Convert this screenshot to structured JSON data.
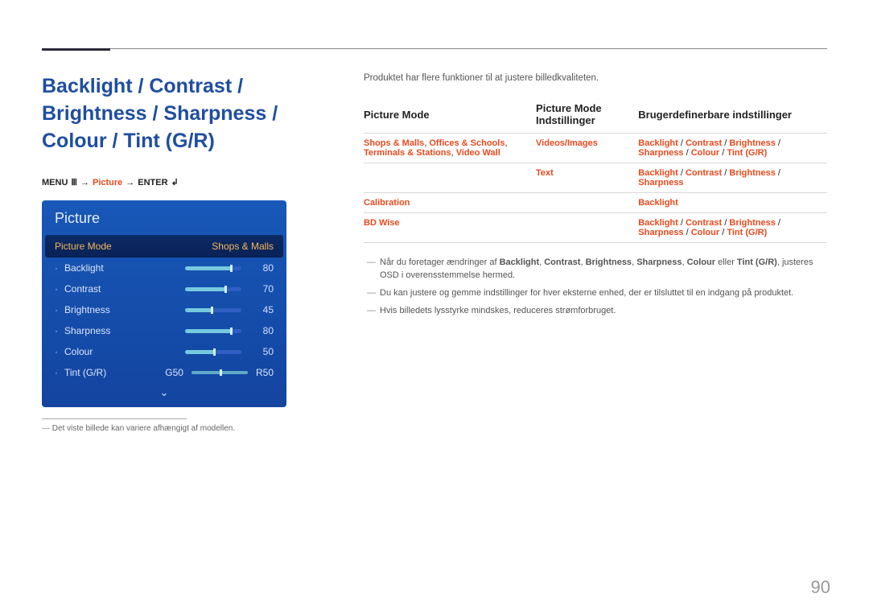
{
  "page_number": "90",
  "title": "Backlight / Contrast / Brightness / Sharpness / Colour / Tint (G/R)",
  "breadcrumb": {
    "menu": "MENU",
    "arrow": "→",
    "picture": "Picture",
    "enter": "ENTER"
  },
  "osd": {
    "header": "Picture",
    "mode_label": "Picture Mode",
    "mode_value": "Shops & Malls",
    "rows": [
      {
        "label": "Backlight",
        "value": "80",
        "pct": "80%"
      },
      {
        "label": "Contrast",
        "value": "70",
        "pct": "70%"
      },
      {
        "label": "Brightness",
        "value": "45",
        "pct": "45%"
      },
      {
        "label": "Sharpness",
        "value": "80",
        "pct": "80%"
      },
      {
        "label": "Colour",
        "value": "50",
        "pct": "50%"
      }
    ],
    "tint": {
      "label": "Tint (G/R)",
      "g": "G50",
      "r": "R50"
    }
  },
  "left_footnote": "Det viste billede kan variere afhængigt af modellen.",
  "intro": "Produktet har flere funktioner til at justere billedkvaliteten.",
  "table": {
    "headers": [
      "Picture Mode",
      "Picture Mode Indstillinger",
      "Brugerdefinerbare indstillinger"
    ],
    "rows": [
      {
        "c1_parts": [
          "Shops & Malls",
          ", ",
          "Offices & Schools",
          ", ",
          "Terminals & Stations",
          ", ",
          "Video Wall"
        ],
        "c2": "Videos/Images",
        "c3_parts": [
          "Backlight",
          " / ",
          "Contrast",
          " / ",
          "Brightness",
          " / ",
          "Sharpness",
          " / ",
          "Colour",
          " / ",
          "Tint (G/R)"
        ]
      },
      {
        "c1_parts": [],
        "c2": "Text",
        "c3_parts": [
          "Backlight",
          " / ",
          "Contrast",
          " / ",
          "Brightness",
          " / ",
          "Sharpness"
        ]
      },
      {
        "c1_parts": [
          "Calibration"
        ],
        "c2": "",
        "c3_parts": [
          "Backlight"
        ]
      },
      {
        "c1_parts": [
          "BD Wise"
        ],
        "c2": "",
        "c3_parts": [
          "Backlight",
          " / ",
          "Contrast",
          " / ",
          "Brightness",
          " / ",
          "Sharpness",
          " / ",
          "Colour",
          " / ",
          "Tint (G/R)"
        ]
      }
    ]
  },
  "notes": {
    "n1_pre": "Når du foretager ændringer af ",
    "n1_bold": [
      "Backlight",
      "Contrast",
      "Brightness",
      "Sharpness",
      "Colour"
    ],
    "n1_mid": " eller ",
    "n1_last": "Tint (G/R)",
    "n1_post": ", justeres OSD i overensstemmelse hermed.",
    "n2": "Du kan justere og gemme indstillinger for hver eksterne enhed, der er tilsluttet til en indgang på produktet.",
    "n3": "Hvis billedets lysstyrke mindskes, reduceres strømforbruget."
  }
}
